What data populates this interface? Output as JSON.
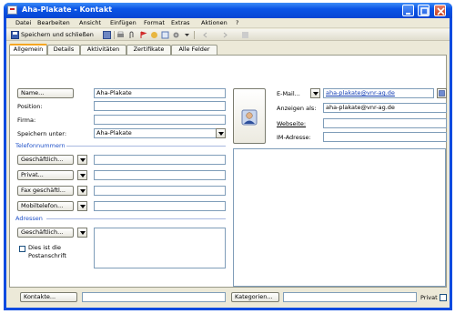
{
  "window": {
    "title": "Aha-Plakate - Kontakt"
  },
  "menu": [
    "Datei",
    "Bearbeiten",
    "Ansicht",
    "Einfügen",
    "Format",
    "Extras",
    "Aktionen",
    "?"
  ],
  "toolbar": {
    "save_close_label": "Speichern und schließen"
  },
  "tabs": [
    "Allgemein",
    "Details",
    "Aktivitäten",
    "Zertifikate",
    "Alle Felder"
  ],
  "general": {
    "name_button": "Name...",
    "name_value": "Aha-Plakate",
    "position_label": "Position:",
    "position_value": "",
    "company_label": "Firma:",
    "company_value": "",
    "save_as_label": "Speichern unter:",
    "save_as_value": "Aha-Plakate"
  },
  "phones": {
    "section_label": "Telefonnummern",
    "items": [
      {
        "label": "Geschäftlich...",
        "value": ""
      },
      {
        "label": "Privat...",
        "value": ""
      },
      {
        "label": "Fax geschäftl...",
        "value": ""
      },
      {
        "label": "Mobiltelefon...",
        "value": ""
      }
    ]
  },
  "addresses": {
    "section_label": "Adressen",
    "type_button": "Geschäftlich...",
    "postal_checkbox_label": "Dies ist die Postanschrift",
    "postal_checked": false,
    "value": ""
  },
  "internet": {
    "email_button": "E-Mail...",
    "email_value": "aha-plakate@vnr-ag.de",
    "display_label": "Anzeigen als:",
    "display_value": "aha-plakate@vnr-ag.de",
    "web_label": "Webseite:",
    "web_value": "",
    "im_label": "IM-Adresse:",
    "im_value": ""
  },
  "footer": {
    "contacts_button": "Kontakte...",
    "contacts_value": "",
    "categories_button": "Kategorien...",
    "categories_value": "",
    "private_label": "Privat",
    "private_checked": false
  },
  "colors": {
    "title_blue": "#0a54e6",
    "section_blue": "#1e50c8",
    "tab_accent": "#f5a623"
  },
  "icons": [
    "contact-card-icon",
    "minimize-icon",
    "maximize-icon",
    "close-icon",
    "save-icon",
    "contact-photo-icon",
    "address-book-icon"
  ]
}
